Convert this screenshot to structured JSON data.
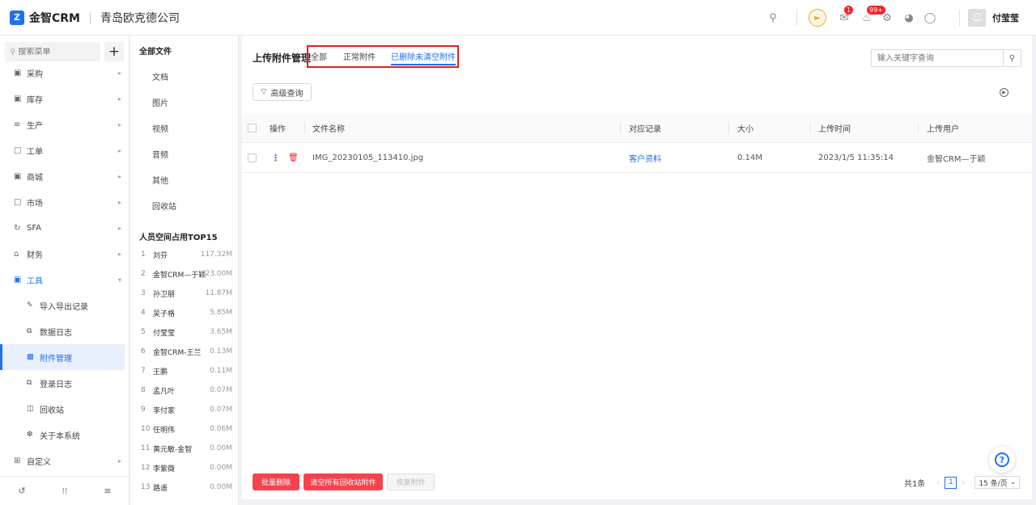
{
  "app": {
    "logo_char": "Z",
    "name": "金智CRM",
    "company": "青岛欧克德公司"
  },
  "topbar": {
    "badge_msg": "1",
    "badge_notice": "99+",
    "user_name": "付莹莹"
  },
  "sidebar": {
    "search_placeholder": "搜索菜单",
    "items": [
      {
        "label": "采购",
        "icon": "cart-icon"
      },
      {
        "label": "库存",
        "icon": "warehouse-icon"
      },
      {
        "label": "生产",
        "icon": "production-icon"
      },
      {
        "label": "工单",
        "icon": "ticket-icon"
      },
      {
        "label": "商城",
        "icon": "store-icon"
      },
      {
        "label": "市场",
        "icon": "market-icon"
      },
      {
        "label": "SFA",
        "icon": "sfa-icon"
      },
      {
        "label": "财务",
        "icon": "finance-icon"
      },
      {
        "label": "工具",
        "icon": "toolbox-icon"
      }
    ],
    "tool_subitems": [
      {
        "label": "导入导出记录"
      },
      {
        "label": "数据日志"
      },
      {
        "label": "附件管理"
      },
      {
        "label": "登录日志"
      },
      {
        "label": "回收站"
      },
      {
        "label": "关于本系统"
      }
    ],
    "custom": {
      "label": "自定义"
    }
  },
  "folder": {
    "title": "全部文件",
    "items": [
      "文档",
      "图片",
      "视频",
      "音频",
      "其他",
      "回收站"
    ],
    "top15_title": "人员空间占用TOP15",
    "ranking": [
      {
        "n": "1",
        "name": "刘芬",
        "size": "117.32M"
      },
      {
        "n": "2",
        "name": "金智CRM—于颖",
        "size": "23.00M"
      },
      {
        "n": "3",
        "name": "孙卫朋",
        "size": "11.87M"
      },
      {
        "n": "4",
        "name": "吴子格",
        "size": "5.85M"
      },
      {
        "n": "5",
        "name": "付莹莹",
        "size": "3.65M"
      },
      {
        "n": "6",
        "name": "金智CRM-王兰",
        "size": "0.13M"
      },
      {
        "n": "7",
        "name": "王鹏",
        "size": "0.11M"
      },
      {
        "n": "8",
        "name": "孟凡叶",
        "size": "0.07M"
      },
      {
        "n": "9",
        "name": "李付家",
        "size": "0.07M"
      },
      {
        "n": "10",
        "name": "任明伟",
        "size": "0.06M"
      },
      {
        "n": "11",
        "name": "黄元敏-金智",
        "size": "0.00M"
      },
      {
        "n": "12",
        "name": "李紫薇",
        "size": "0.00M"
      },
      {
        "n": "13",
        "name": "路遥",
        "size": "0.00M"
      }
    ]
  },
  "main": {
    "title": "上传附件管理",
    "tabs": [
      "全部",
      "正常附件",
      "已删除未清空附件"
    ],
    "search_placeholder": "输入关键字查询",
    "advanced_label": "高级查询",
    "columns": [
      "操作",
      "文件名称",
      "对应记录",
      "大小",
      "上传时间",
      "上传用户"
    ],
    "rows": [
      {
        "filename": "IMG_20230105_113410.jpg",
        "record": "客户资料",
        "size": "0.14M",
        "time": "2023/1/5 11:35:14",
        "user": "金智CRM—于颖"
      }
    ],
    "buttons": {
      "batch_delete": "批量删除",
      "clear_recycle": "清空所有回收站附件",
      "restore": "恢复附件"
    },
    "pager": {
      "total": "共1条",
      "page": "1",
      "page_size": "15 条/页"
    }
  },
  "colors": {
    "primary": "#1f6ff2",
    "danger": "#f5424d",
    "highlight_box": "#e02020"
  }
}
